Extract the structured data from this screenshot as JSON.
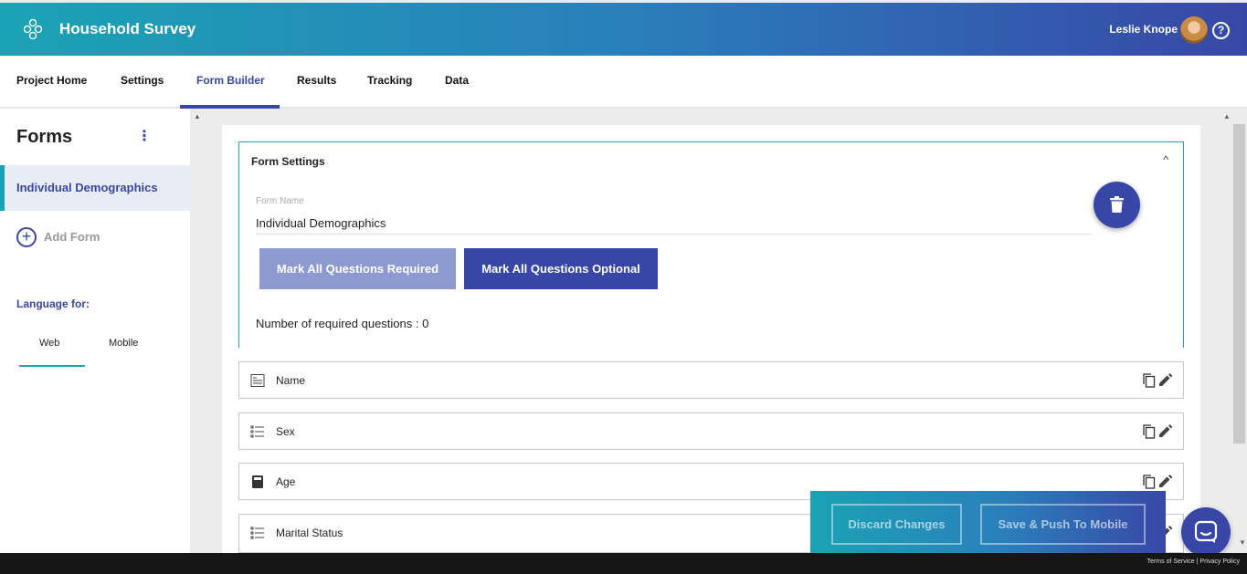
{
  "header": {
    "app_title": "Household Survey",
    "user_name": "Leslie Knope",
    "help_glyph": "?"
  },
  "nav": {
    "tabs": [
      {
        "label": "Project Home"
      },
      {
        "label": "Settings"
      },
      {
        "label": "Form Builder",
        "active": true
      },
      {
        "label": "Results"
      },
      {
        "label": "Tracking"
      },
      {
        "label": "Data"
      }
    ]
  },
  "sidebar": {
    "title": "Forms",
    "forms": [
      {
        "label": "Individual Demographics",
        "selected": true
      }
    ],
    "add_form_label": "Add Form",
    "language_label": "Language for:",
    "language_tabs": [
      {
        "label": "Web",
        "active": true
      },
      {
        "label": "Mobile"
      }
    ]
  },
  "form_settings": {
    "title": "Form Settings",
    "form_name_label": "Form Name",
    "form_name_value": "Individual Demographics",
    "btn_required": "Mark All Questions Required",
    "btn_optional": "Mark All Questions Optional",
    "required_count_text": "Number of required questions : 0"
  },
  "questions": [
    {
      "label": "Name",
      "icon": "text-field-icon"
    },
    {
      "label": "Sex",
      "icon": "list-icon"
    },
    {
      "label": "Age",
      "icon": "calculator-icon"
    },
    {
      "label": "Marital Status",
      "icon": "list-icon"
    }
  ],
  "actions": {
    "discard_label": "Discard Changes",
    "save_label": "Save & Push To Mobile"
  },
  "footer": {
    "terms": "Terms of Service",
    "privacy": "Privacy Policy",
    "separator": "|"
  },
  "colors": {
    "primary": "#3847a7",
    "accent": "#1aa3b4"
  }
}
